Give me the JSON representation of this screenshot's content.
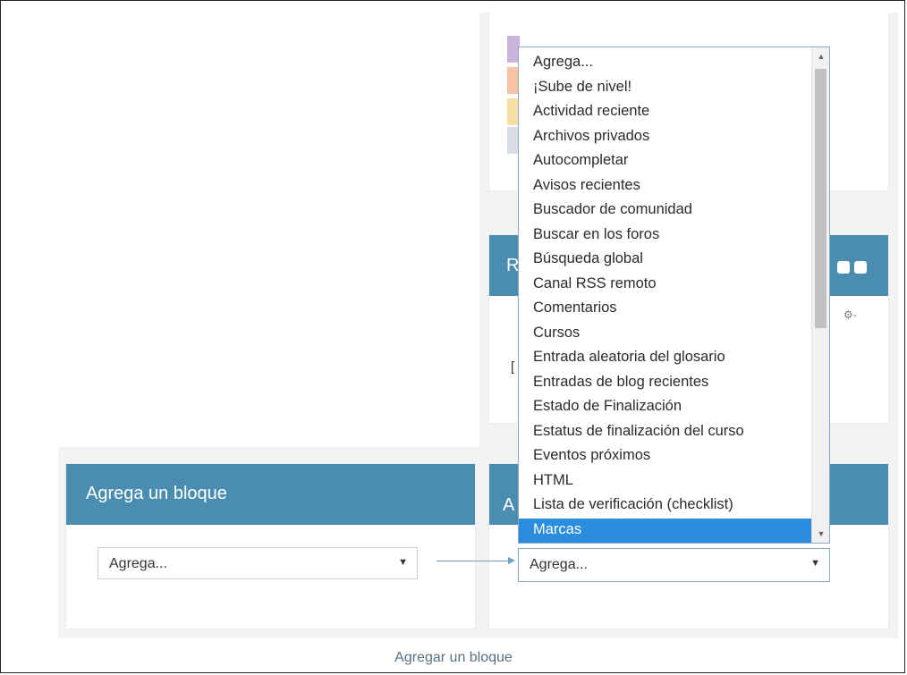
{
  "left_block": {
    "title": "Agrega un bloque",
    "select_value": "Agrega..."
  },
  "right_block": {
    "title_peek": "A",
    "select_value": "Agrega..."
  },
  "background_block": {
    "title_peek": "R",
    "text_peek": "[",
    "settings_peek": "⚙-"
  },
  "dropdown": {
    "options": [
      "Agrega...",
      "¡Sube de nivel!",
      "Actividad reciente",
      "Archivos privados",
      "Autocompletar",
      "Avisos recientes",
      "Buscador de comunidad",
      "Buscar en los foros",
      "Búsqueda global",
      "Canal RSS remoto",
      "Comentarios",
      "Cursos",
      "Entrada aleatoria del glosario",
      "Entradas de blog recientes",
      "Estado de Finalización",
      "Estatus de finalización del curso",
      "Eventos próximos",
      "HTML",
      "Lista de verificación (checklist)",
      "Marcas"
    ],
    "selected": "Marcas"
  },
  "footer": {
    "link": "Agregar un bloque"
  },
  "colors": {
    "header_blue": "#4a8db0",
    "selection_blue": "#2a8dde"
  }
}
